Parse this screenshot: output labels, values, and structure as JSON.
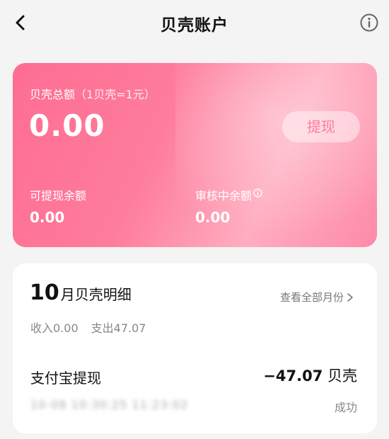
{
  "nav": {
    "title": "贝壳账户",
    "back_icon": "chevron-left-icon",
    "info_icon": "info-circle-icon"
  },
  "balance": {
    "total_label": "贝壳总额",
    "rate_note": "（1贝壳=1元）",
    "total_value": "0.00",
    "withdraw_label": "提现",
    "withdrawable_label": "可提现余额",
    "withdrawable_value": "0.00",
    "pending_label": "审核中余额",
    "pending_value": "0.00",
    "accent_color": "#fe6d93"
  },
  "detail": {
    "month_number": "10",
    "month_title": "月贝壳明细",
    "view_all_label": "查看全部月份",
    "income_label": "收入0.00",
    "expense_label": "支出47.07",
    "transactions": [
      {
        "title": "支付宝提现",
        "amount": "−47.07",
        "unit": "贝壳",
        "time": "10-08 10:30:25 11:23:02",
        "status": "成功"
      }
    ]
  }
}
